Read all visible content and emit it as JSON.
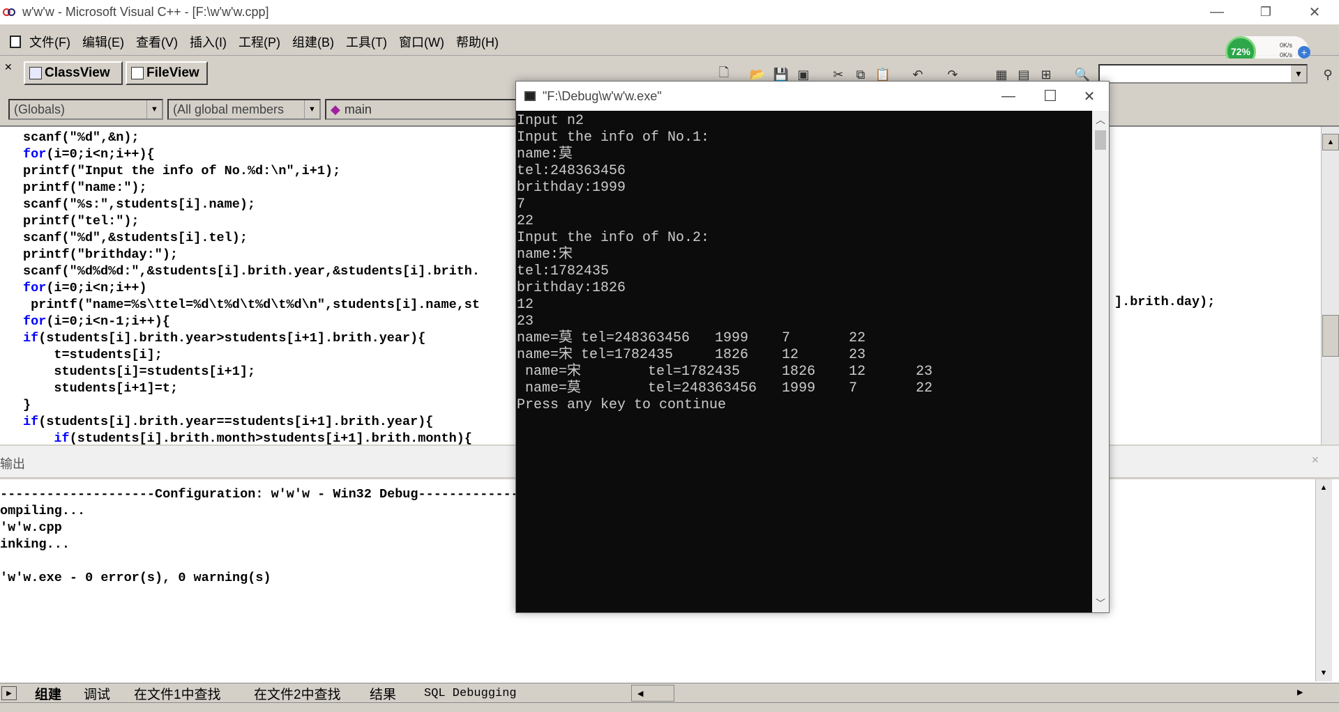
{
  "window": {
    "title": "w'w'w - Microsoft Visual C++ - [F:\\w'w'w.cpp]",
    "minimize": "—",
    "restore": "❐",
    "close": "✕"
  },
  "menu": [
    "文件(F)",
    "编辑(E)",
    "查看(V)",
    "插入(I)",
    "工程(P)",
    "组建(B)",
    "工具(T)",
    "窗口(W)",
    "帮助(H)"
  ],
  "workspace_tabs": {
    "classview": "ClassView",
    "fileview": "FileView"
  },
  "wizard": {
    "scope": "(Globals)",
    "members": "(All global members",
    "function": "main"
  },
  "network": {
    "percent": "72%",
    "up": "0K/s",
    "down": "0K/s"
  },
  "code_lines": [
    {
      "pre": "",
      "kw": "",
      "rest": "scanf(\"%d\",&n);"
    },
    {
      "pre": "",
      "kw": "for",
      "rest": "(i=0;i<n;i++){"
    },
    {
      "pre": "",
      "kw": "",
      "rest": "printf(\"Input the info of No.%d:\\n\",i+1);"
    },
    {
      "pre": "",
      "kw": "",
      "rest": "printf(\"name:\");"
    },
    {
      "pre": "",
      "kw": "",
      "rest": "scanf(\"%s:\",students[i].name);"
    },
    {
      "pre": "",
      "kw": "",
      "rest": "printf(\"tel:\");"
    },
    {
      "pre": "",
      "kw": "",
      "rest": "scanf(\"%d\",&students[i].tel);"
    },
    {
      "pre": "",
      "kw": "",
      "rest": "printf(\"brithday:\");"
    },
    {
      "pre": "",
      "kw": "",
      "rest": "scanf(\"%d%d%d:\",&students[i].brith.year,&students[i].brith."
    },
    {
      "pre": "",
      "kw": "for",
      "rest": "(i=0;i<n;i++)"
    },
    {
      "pre": " ",
      "kw": "",
      "rest": "printf(\"name=%s\\ttel=%d\\t%d\\t%d\\t%d\\n\",students[i].name,st"
    },
    {
      "pre": "",
      "kw": "for",
      "rest": "(i=0;i<n-1;i++){"
    },
    {
      "pre": "",
      "kw": "if",
      "rest": "(students[i].brith.year>students[i+1].brith.year){"
    },
    {
      "pre": "    ",
      "kw": "",
      "rest": "t=students[i];"
    },
    {
      "pre": "    ",
      "kw": "",
      "rest": "students[i]=students[i+1];"
    },
    {
      "pre": "    ",
      "kw": "",
      "rest": "students[i+1]=t;"
    },
    {
      "pre": "",
      "kw": "",
      "rest": "}"
    },
    {
      "pre": "",
      "kw": "if",
      "rest": "(students[i].brith.year==students[i+1].brith.year){"
    },
    {
      "pre": "    ",
      "kw": "if",
      "rest": "(students[i].brith.month>students[i+1].brith.month){"
    }
  ],
  "code_overflow_right": "].brith.day);",
  "output": {
    "title": "输出",
    "lines": [
      "--------------------Configuration: w'w'w - Win32 Debug--------------------",
      "ompiling...",
      "'w'w.cpp",
      "inking...",
      "",
      "'w'w.exe - 0 error(s), 0 warning(s)"
    ]
  },
  "bottom_tabs": [
    "组建",
    "调试",
    "在文件1中查找",
    "在文件2中查找",
    "结果",
    "SQL Debugging"
  ],
  "console": {
    "title": "\"F:\\Debug\\w'w'w.exe\"",
    "lines": [
      "Input n2",
      "Input the info of No.1:",
      "name:莫",
      "tel:248363456",
      "brithday:1999",
      "7",
      "22",
      "Input the info of No.2:",
      "name:宋",
      "tel:1782435",
      "brithday:1826",
      "12",
      "23",
      "name=莫 tel=248363456   1999    7       22",
      "name=宋 tel=1782435     1826    12      23",
      " name=宋        tel=1782435     1826    12      23",
      " name=莫        tel=248363456   1999    7       22",
      "Press any key to continue"
    ]
  },
  "colors": {
    "keyword": "#0000ff",
    "console_bg": "#0c0c0c",
    "console_text": "#cccccc",
    "gauge": "#2ea64a"
  }
}
